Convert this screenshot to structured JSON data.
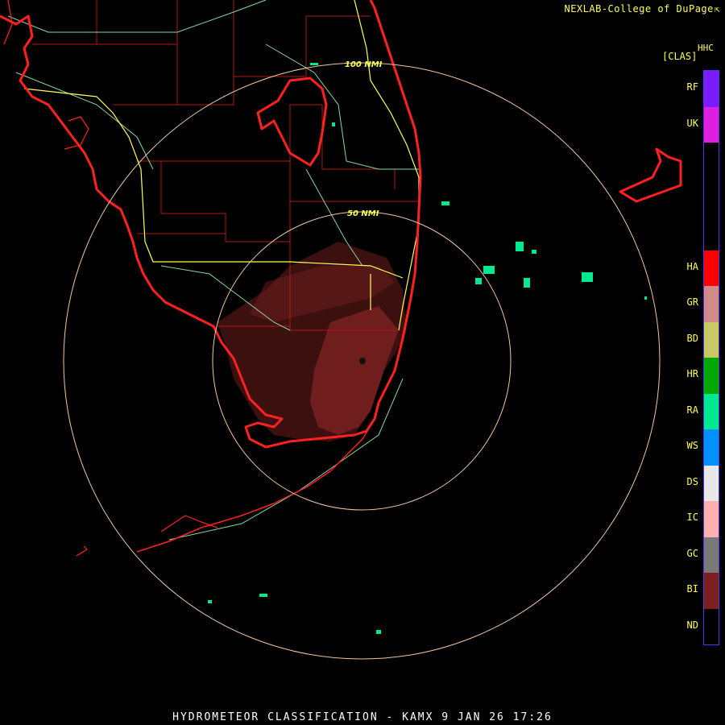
{
  "header": {
    "credit": "NEXLAB-College of DuPage",
    "credit_icon": "cursor-arrow-icon"
  },
  "footer": {
    "caption": "HYDROMETEOR CLASSIFICATION - KAMX 9 JAN 26 17:26"
  },
  "radar": {
    "site": "KAMX",
    "range_rings": [
      {
        "label": "50 NMI",
        "range_nmi": 50
      },
      {
        "label": "100 NMI",
        "range_nmi": 100
      }
    ]
  },
  "legend": {
    "product": "HHC",
    "unit": "[CLAS]",
    "classes": [
      {
        "code": "RF",
        "color": "#7a1cff"
      },
      {
        "code": "UK",
        "color": "#e01ee0"
      },
      {
        "code": "",
        "color": "#000000"
      },
      {
        "code": "",
        "color": "#000000"
      },
      {
        "code": "",
        "color": "#000000"
      },
      {
        "code": "HA",
        "color": "#ff0000"
      },
      {
        "code": "GR",
        "color": "#d08a8a"
      },
      {
        "code": "BD",
        "color": "#c8c864"
      },
      {
        "code": "HR",
        "color": "#00a800"
      },
      {
        "code": "RA",
        "color": "#00e890"
      },
      {
        "code": "WS",
        "color": "#0090ff"
      },
      {
        "code": "DS",
        "color": "#e8e8e8"
      },
      {
        "code": "IC",
        "color": "#ffb0b0"
      },
      {
        "code": "GC",
        "color": "#787878"
      },
      {
        "code": "BI",
        "color": "#7a2020"
      },
      {
        "code": "ND",
        "color": "#000000"
      }
    ]
  },
  "colors": {
    "coast": "#ff2020",
    "county": "#b01818",
    "interstate": "#ffff55",
    "highway": "#88d8a0",
    "range_ring": "#f0c8a0",
    "biological": "#7a2020",
    "rain": "#00e890"
  }
}
